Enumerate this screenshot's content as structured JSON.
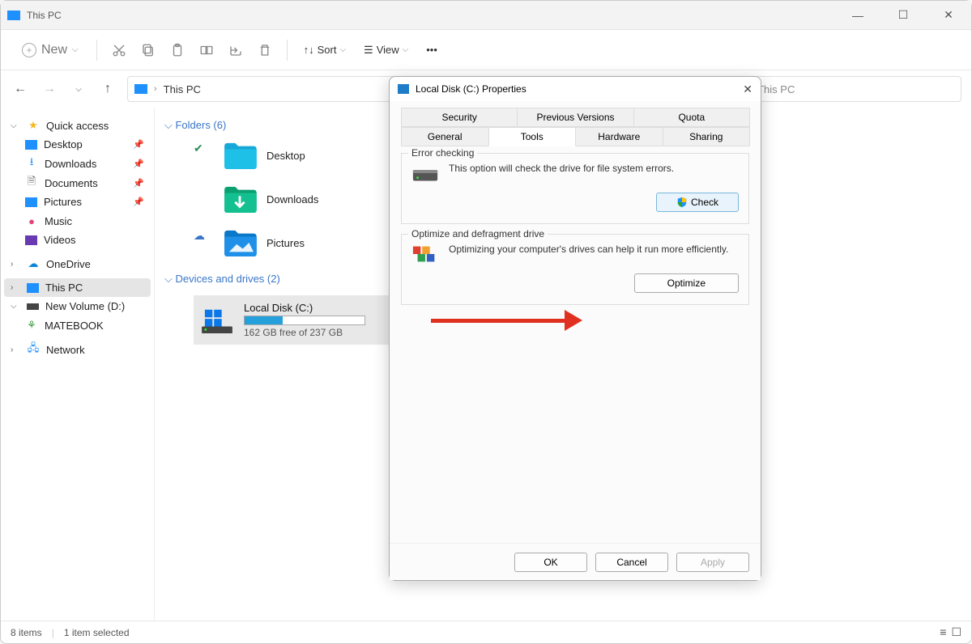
{
  "window": {
    "title": "This PC"
  },
  "toolbar": {
    "new_label": "New",
    "sort_label": "Sort",
    "view_label": "View"
  },
  "address": {
    "location": "This PC"
  },
  "search": {
    "placeholder_suffix": "ch This PC"
  },
  "sidebar": {
    "quick_access": "Quick access",
    "items": [
      {
        "label": "Desktop"
      },
      {
        "label": "Downloads"
      },
      {
        "label": "Documents"
      },
      {
        "label": "Pictures"
      },
      {
        "label": "Music"
      },
      {
        "label": "Videos"
      }
    ],
    "onedrive": "OneDrive",
    "this_pc": "This PC",
    "new_volume": "New Volume (D:)",
    "matebook": "MATEBOOK",
    "network": "Network"
  },
  "main": {
    "folders_header": "Folders (6)",
    "folders": [
      {
        "label": "Desktop"
      },
      {
        "label": "Downloads"
      },
      {
        "label": "Pictures"
      }
    ],
    "devices_header": "Devices and drives (2)",
    "disk": {
      "name": "Local Disk (C:)",
      "free_text": "162 GB free of 237 GB",
      "fill_pct": 32
    }
  },
  "status": {
    "items": "8 items",
    "selected": "1 item selected"
  },
  "dialog": {
    "title": "Local Disk (C:) Properties",
    "tabs_row1": [
      "Security",
      "Previous Versions",
      "Quota"
    ],
    "tabs_row2": [
      "General",
      "Tools",
      "Hardware",
      "Sharing"
    ],
    "error_checking": {
      "legend": "Error checking",
      "text": "This option will check the drive for file system errors.",
      "button": "Check"
    },
    "optimize": {
      "legend": "Optimize and defragment drive",
      "text": "Optimizing your computer's drives can help it run more efficiently.",
      "button": "Optimize"
    },
    "footer": {
      "ok": "OK",
      "cancel": "Cancel",
      "apply": "Apply"
    }
  }
}
